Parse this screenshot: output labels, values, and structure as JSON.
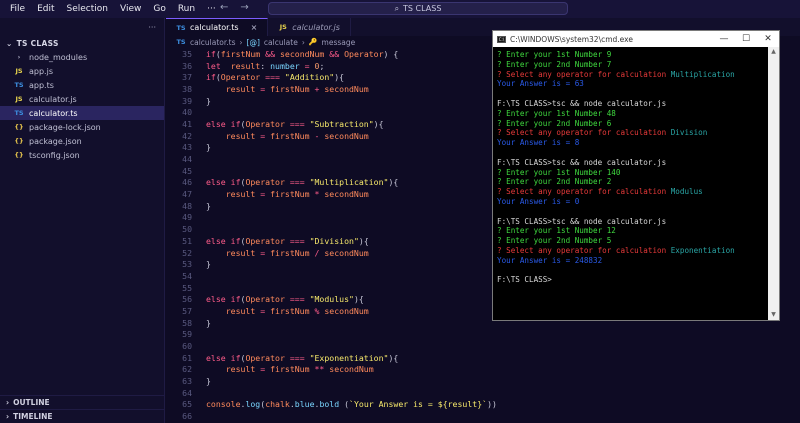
{
  "menu": {
    "file": "File",
    "edit": "Edit",
    "selection": "Selection",
    "view": "View",
    "go": "Go",
    "run": "Run",
    "more": "···"
  },
  "search": {
    "text": "TS CLASS"
  },
  "sidebar": {
    "title": "TS CLASS",
    "items": [
      {
        "label": "node_modules",
        "icon": "folder",
        "badge": "›"
      },
      {
        "label": "app.js",
        "icon": "js",
        "badge": "JS"
      },
      {
        "label": "app.ts",
        "icon": "ts",
        "badge": "TS"
      },
      {
        "label": "calculator.js",
        "icon": "js",
        "badge": "JS"
      },
      {
        "label": "calculator.ts",
        "icon": "ts",
        "badge": "TS"
      },
      {
        "label": "package-lock.json",
        "icon": "json",
        "badge": "{}"
      },
      {
        "label": "package.json",
        "icon": "json",
        "badge": "{}"
      },
      {
        "label": "tsconfig.json",
        "icon": "json",
        "badge": "{}"
      }
    ],
    "outline": "OUTLINE",
    "timeline": "TIMELINE"
  },
  "tabs": [
    {
      "label": "calculator.ts",
      "badge": "TS",
      "close": "×"
    },
    {
      "label": "calculator.js",
      "badge": "JS"
    }
  ],
  "breadcrumb": {
    "file_badge": "TS",
    "file": "calculator.ts",
    "sep1": "›",
    "func_icon": "[@]",
    "func": "calculate",
    "sep2": "›",
    "prop_icon": "🔑",
    "prop": "message"
  },
  "code_lines": [
    {
      "n": "35",
      "t": "if(firstNum && secondNum && Operator) {"
    },
    {
      "n": "36",
      "t": "let  result: number = 0;"
    },
    {
      "n": "37",
      "t": "if(Operator === \"Addition\"){"
    },
    {
      "n": "38",
      "t": "    result = firstNum + secondNum"
    },
    {
      "n": "39",
      "t": "}"
    },
    {
      "n": "40",
      "t": ""
    },
    {
      "n": "41",
      "t": "else if(Operator === \"Subtraction\"){"
    },
    {
      "n": "42",
      "t": "    result = firstNum - secondNum"
    },
    {
      "n": "43",
      "t": "}"
    },
    {
      "n": "44",
      "t": ""
    },
    {
      "n": "45",
      "t": ""
    },
    {
      "n": "46",
      "t": "else if(Operator === \"Multiplication\"){"
    },
    {
      "n": "47",
      "t": "    result = firstNum * secondNum"
    },
    {
      "n": "48",
      "t": "}"
    },
    {
      "n": "49",
      "t": ""
    },
    {
      "n": "50",
      "t": ""
    },
    {
      "n": "51",
      "t": "else if(Operator === \"Division\"){"
    },
    {
      "n": "52",
      "t": "    result = firstNum / secondNum"
    },
    {
      "n": "53",
      "t": "}"
    },
    {
      "n": "54",
      "t": ""
    },
    {
      "n": "55",
      "t": ""
    },
    {
      "n": "56",
      "t": "else if(Operator === \"Modulus\"){"
    },
    {
      "n": "57",
      "t": "    result = firstNum % secondNum"
    },
    {
      "n": "58",
      "t": "}"
    },
    {
      "n": "59",
      "t": ""
    },
    {
      "n": "60",
      "t": ""
    },
    {
      "n": "61",
      "t": "else if(Operator === \"Exponentiation\"){"
    },
    {
      "n": "62",
      "t": "    result = firstNum ** secondNum"
    },
    {
      "n": "63",
      "t": "}"
    },
    {
      "n": "64",
      "t": ""
    },
    {
      "n": "65",
      "t": "console.log(chalk.blue.bold (`Your Answer is = ${result}`))"
    },
    {
      "n": "66",
      "t": ""
    }
  ],
  "cmd": {
    "title": "C:\\WINDOWS\\system32\\cmd.exe",
    "controls": [
      "—",
      "☐",
      "✕"
    ],
    "lines": [
      {
        "text": "? Enter your 1st Number 9",
        "color": "green"
      },
      {
        "text": "? Enter your 2nd Number 7",
        "color": "green"
      },
      {
        "text": "? Select any operator for calculation ",
        "color": "red",
        "extra": "Multiplication"
      },
      {
        "text": "Your Answer is = 63",
        "color": "blue"
      },
      {
        "text": "",
        "color": "white"
      },
      {
        "text": "F:\\TS CLASS>tsc && node calculator.js",
        "color": "white"
      },
      {
        "text": "? Enter your 1st Number 48",
        "color": "green"
      },
      {
        "text": "? Enter your 2nd Number 6",
        "color": "green"
      },
      {
        "text": "? Select any operator for calculation ",
        "color": "red",
        "extra": "Division"
      },
      {
        "text": "Your Answer is = 8",
        "color": "blue"
      },
      {
        "text": "",
        "color": "white"
      },
      {
        "text": "F:\\TS CLASS>tsc && node calculator.js",
        "color": "white"
      },
      {
        "text": "? Enter your 1st Number 140",
        "color": "green"
      },
      {
        "text": "? Enter your 2nd Number 2",
        "color": "green"
      },
      {
        "text": "? Select any operator for calculation ",
        "color": "red",
        "extra": "Modulus"
      },
      {
        "text": "Your Answer is = 0",
        "color": "blue"
      },
      {
        "text": "",
        "color": "white"
      },
      {
        "text": "F:\\TS CLASS>tsc && node calculator.js",
        "color": "white"
      },
      {
        "text": "? Enter your 1st Number 12",
        "color": "green"
      },
      {
        "text": "? Enter your 2nd Number 5",
        "color": "green"
      },
      {
        "text": "? Select any operator for calculation ",
        "color": "red",
        "extra": "Exponentiation"
      },
      {
        "text": "Your Answer is = 248832",
        "color": "blue"
      },
      {
        "text": "",
        "color": "white"
      },
      {
        "text": "F:\\TS CLASS>",
        "color": "white"
      }
    ]
  },
  "colors": {
    "accent": "#7c5cff",
    "bg": "#0e0b24",
    "sidebar": "#120f2c"
  }
}
